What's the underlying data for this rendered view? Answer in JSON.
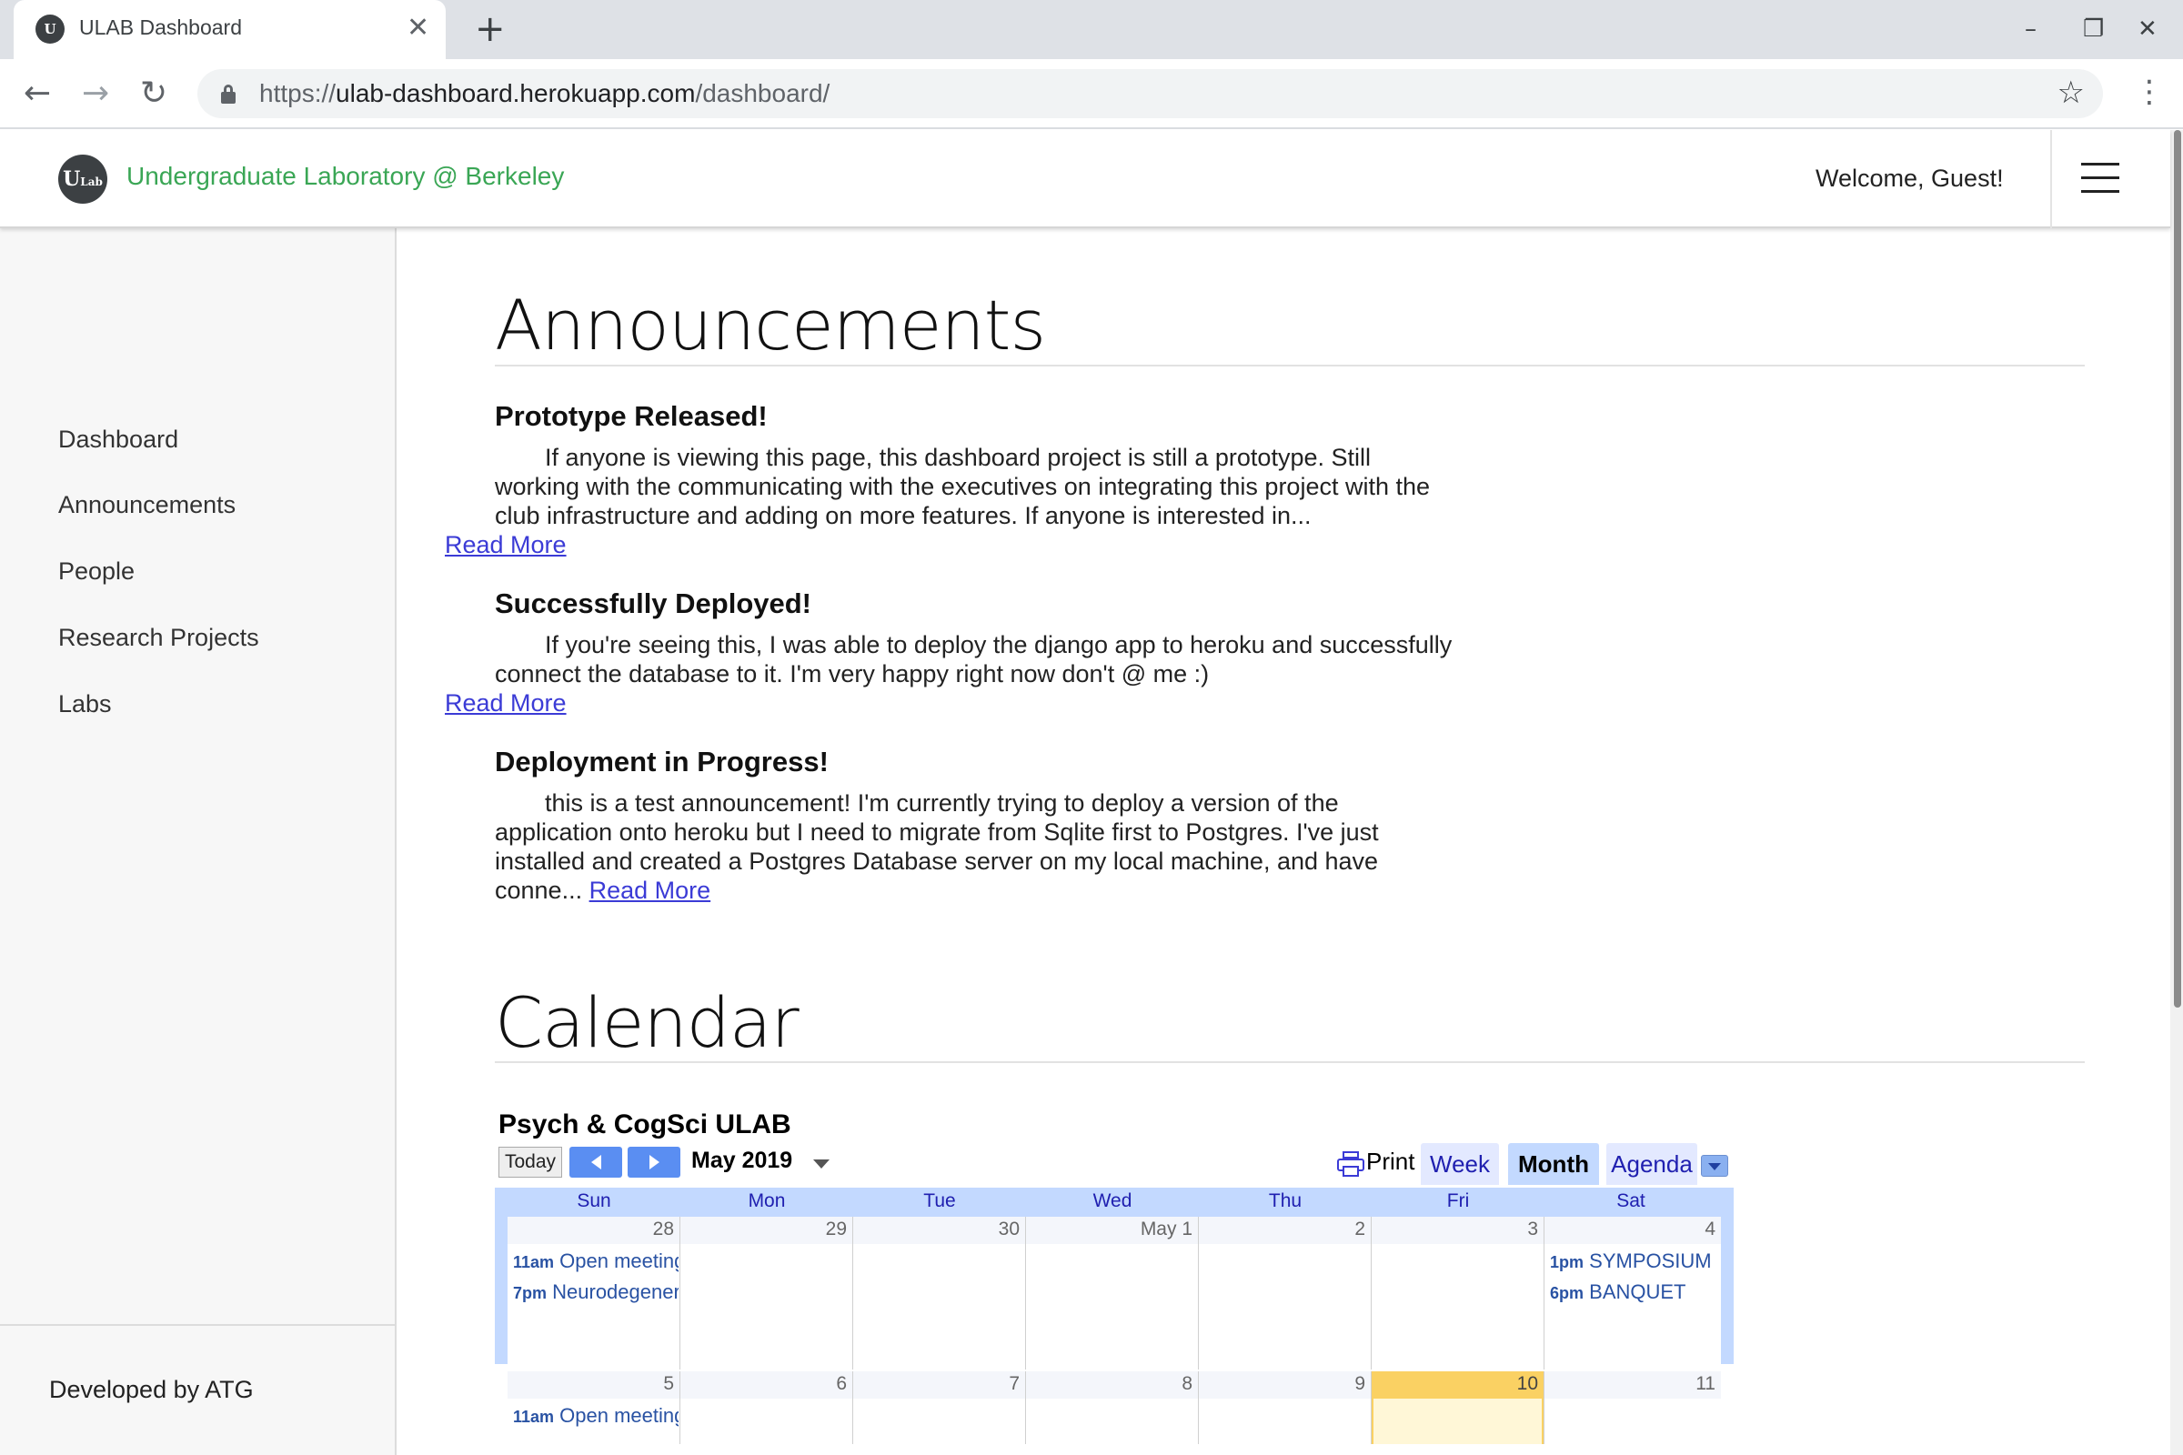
{
  "browser": {
    "tab_title": "ULAB Dashboard",
    "favicon_text": "U",
    "url_prefix": "https://",
    "url_host": "ulab-dashboard.herokuapp.com",
    "url_path": "/dashboard/"
  },
  "header": {
    "logo_text": "U",
    "logo_small": "Lab",
    "site_title": "Undergraduate Laboratory @ Berkeley",
    "welcome": "Welcome, Guest!"
  },
  "sidebar": {
    "items": [
      {
        "label": "Dashboard"
      },
      {
        "label": "Announcements"
      },
      {
        "label": "People"
      },
      {
        "label": "Research Projects"
      },
      {
        "label": "Labs"
      }
    ],
    "footer": "Developed by ATG"
  },
  "announcements": {
    "heading": "Announcements",
    "items": [
      {
        "title": "Prototype Released!",
        "body": "If anyone is viewing this page, this dashboard project is still a prototype. Still working with the communicating with the executives on integrating this project with the club infrastructure and adding on more features. If anyone is interested in...",
        "read_more": "Read More"
      },
      {
        "title": "Successfully Deployed!",
        "body": "If you're seeing this, I was able to deploy the django app to heroku and successfully connect the database to it. I'm very happy right now don't @ me :)",
        "read_more": "Read More"
      },
      {
        "title": "Deployment in Progress!",
        "body": "this is a test announcement! I'm currently trying to deploy a version of the application onto heroku but I need to migrate from Sqlite first to Postgres. I've just installed and created a Postgres Database server on my local machine, and have conne...",
        "read_more": "Read More"
      }
    ]
  },
  "calendar": {
    "heading": "Calendar",
    "name": "Psych & CogSci ULAB",
    "today_label": "Today",
    "month_label": "May 2019",
    "print_label": "Print",
    "views": [
      {
        "label": "Week"
      },
      {
        "label": "Month"
      },
      {
        "label": "Agenda"
      }
    ],
    "active_view": "Month",
    "days_of_week": [
      "Sun",
      "Mon",
      "Tue",
      "Wed",
      "Thu",
      "Fri",
      "Sat"
    ],
    "weeks": [
      {
        "days": [
          "28",
          "29",
          "30",
          "May 1",
          "2",
          "3",
          "4"
        ],
        "events": [
          {
            "day": 0,
            "row": 0,
            "time": "11am",
            "title": "Open meeting"
          },
          {
            "day": 0,
            "row": 1,
            "time": "7pm",
            "title": "Neurodegeneration"
          },
          {
            "day": 6,
            "row": 0,
            "time": "1pm",
            "title": "SYMPOSIUM"
          },
          {
            "day": 6,
            "row": 1,
            "time": "6pm",
            "title": "BANQUET"
          }
        ]
      },
      {
        "days": [
          "5",
          "6",
          "7",
          "8",
          "9",
          "10",
          "11"
        ],
        "today_index": 5,
        "events": [
          {
            "day": 0,
            "row": 0,
            "time": "11am",
            "title": "Open meeting"
          }
        ]
      }
    ],
    "colors": {
      "accent": "#c3d9ff",
      "today": "#fad163",
      "event": "#2952a3"
    }
  }
}
